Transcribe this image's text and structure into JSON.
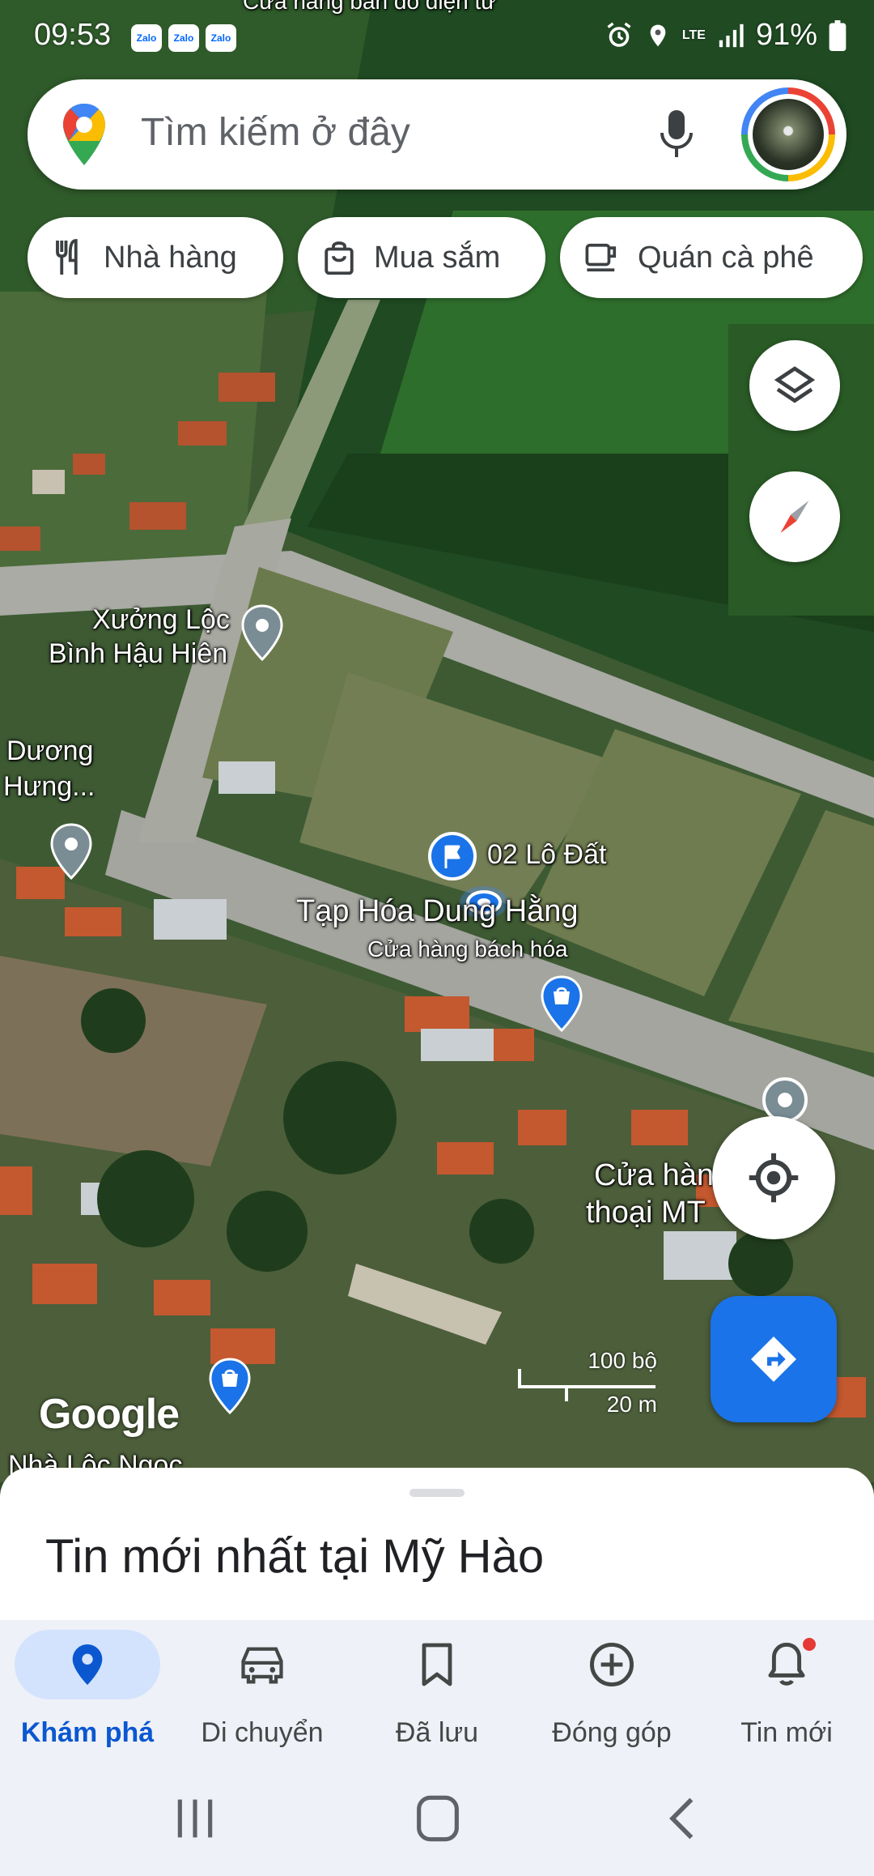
{
  "status_bar": {
    "time": "09:53",
    "notifications": [
      "Zalo",
      "Zalo",
      "Zalo"
    ],
    "icons": [
      "alarm-icon",
      "location-icon",
      "lte-icon",
      "signal-icon",
      "battery-icon"
    ],
    "network": "LTE",
    "battery": "91%"
  },
  "search": {
    "placeholder": "Tìm kiếm ở đây",
    "icons": [
      "google-maps-logo-icon",
      "microphone-icon",
      "profile-avatar"
    ]
  },
  "chips": [
    {
      "label": "Nhà hàng",
      "icon": "restaurant-icon"
    },
    {
      "label": "Mua sắm",
      "icon": "shopping-bag-icon"
    },
    {
      "label": "Quán cà phê",
      "icon": "coffee-icon"
    }
  ],
  "map": {
    "labels": {
      "xuong_loc_1": "Xưởng Lộc",
      "xuong_loc_2": "Bình Hậu Hiên",
      "duong_hung_1": "Dương",
      "duong_hung_2": "Hưng...",
      "lo_dat": "02 Lô Đất",
      "tap_hoa": "Tạp Hóa Dung Hằng",
      "tap_hoa_sub": "Cửa hàng bách hóa",
      "cua_hang_1": "Cửa hàn",
      "cua_hang_2": "thoại MT",
      "bottom_place": "Nhà Lộc Ngọc",
      "top_place": "Cửa hàng bán đồ điện tử"
    },
    "scale_imperial": "100 bộ",
    "scale_metric": "20 m",
    "attribution": "Google",
    "colors": {
      "accent": "#1a73e8",
      "user_location": "#4285f4"
    }
  },
  "controls": {
    "layers": "layers-icon",
    "compass": "compass-icon",
    "my_location": "my-location-icon",
    "directions": "directions-icon"
  },
  "sheet": {
    "title": "Tin mới nhất tại Mỹ Hào"
  },
  "nav": {
    "items": [
      {
        "label": "Khám phá",
        "icon": "explore-pin-icon",
        "active": true
      },
      {
        "label": "Di chuyển",
        "icon": "car-icon",
        "active": false
      },
      {
        "label": "Đã lưu",
        "icon": "bookmark-icon",
        "active": false
      },
      {
        "label": "Đóng góp",
        "icon": "add-circle-icon",
        "active": false
      },
      {
        "label": "Tin mới",
        "icon": "bell-icon",
        "active": false
      }
    ]
  }
}
